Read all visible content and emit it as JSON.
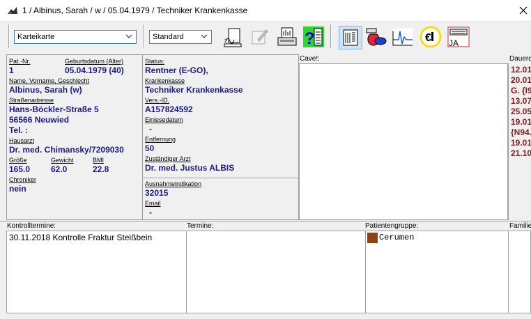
{
  "window": {
    "title": "1 / Albinus, Sarah / w / 05.04.1979 / Techniker Krankenkasse"
  },
  "toolbar": {
    "view_select": "Karteikarte",
    "layout_select": "Standard"
  },
  "patient": {
    "pat_nr_label": "Pat.-Nr.",
    "pat_nr": "1",
    "birth_label": "Geburtsdatum (Alter)",
    "birth": "05.04.1979 (40)",
    "name_label": "Name, Vorname, Geschlecht",
    "name": "Albinus, Sarah (w)",
    "street_label": "Straßenadresse",
    "street": "Hans-Böckler-Straße 5",
    "city": "56566 Neuwied",
    "tel": "Tel. :",
    "doctor_label": "Hausarzt",
    "doctor": "Dr. med. Chimansky/7209030",
    "size_label": "Größe",
    "size": "165.0",
    "weight_label": "Gewicht",
    "weight": "62.0",
    "bmi_label": "BMI",
    "bmi": "22.8",
    "chronic_label": "Chroniker",
    "chronic": "nein"
  },
  "insurance": {
    "status_label": "Status:",
    "status": "Rentner (E-GO),",
    "kasse_label": "Krankenkasse",
    "kasse": "Techniker Krankenkasse",
    "vers_label": "Vers.-ID.",
    "vers": "A157824592",
    "einlese_label": "Einlesedatum",
    "einlese": "-",
    "entfernung_label": "Entfernung",
    "entfernung": "50",
    "arzt_label": "Zuständiger Arzt",
    "arzt": "Dr. med. Justus ALBIS",
    "ausnahme_label": "Ausnahmeindikation",
    "ausnahme": "32015",
    "email_label": "Email",
    "email": "-"
  },
  "cave": {
    "label": "Cave!:"
  },
  "dauer": {
    "label": "Dauerd",
    "items": [
      "12.01",
      "20.01",
      "G. {I9",
      "13.07",
      "25.05",
      "19.01",
      "{N94.",
      "19.01",
      "21.10"
    ]
  },
  "bottom": {
    "kontroll_label": "Kontrolltermine:",
    "kontroll_item": "30.11.2018 Kontrolle Fraktur Steißbein",
    "termine_label": "Termine:",
    "gruppe_label": "Patientengruppe:",
    "gruppe_item": "Cerumen",
    "gruppe_color": "#8b4513",
    "familie_label": "Familie"
  }
}
